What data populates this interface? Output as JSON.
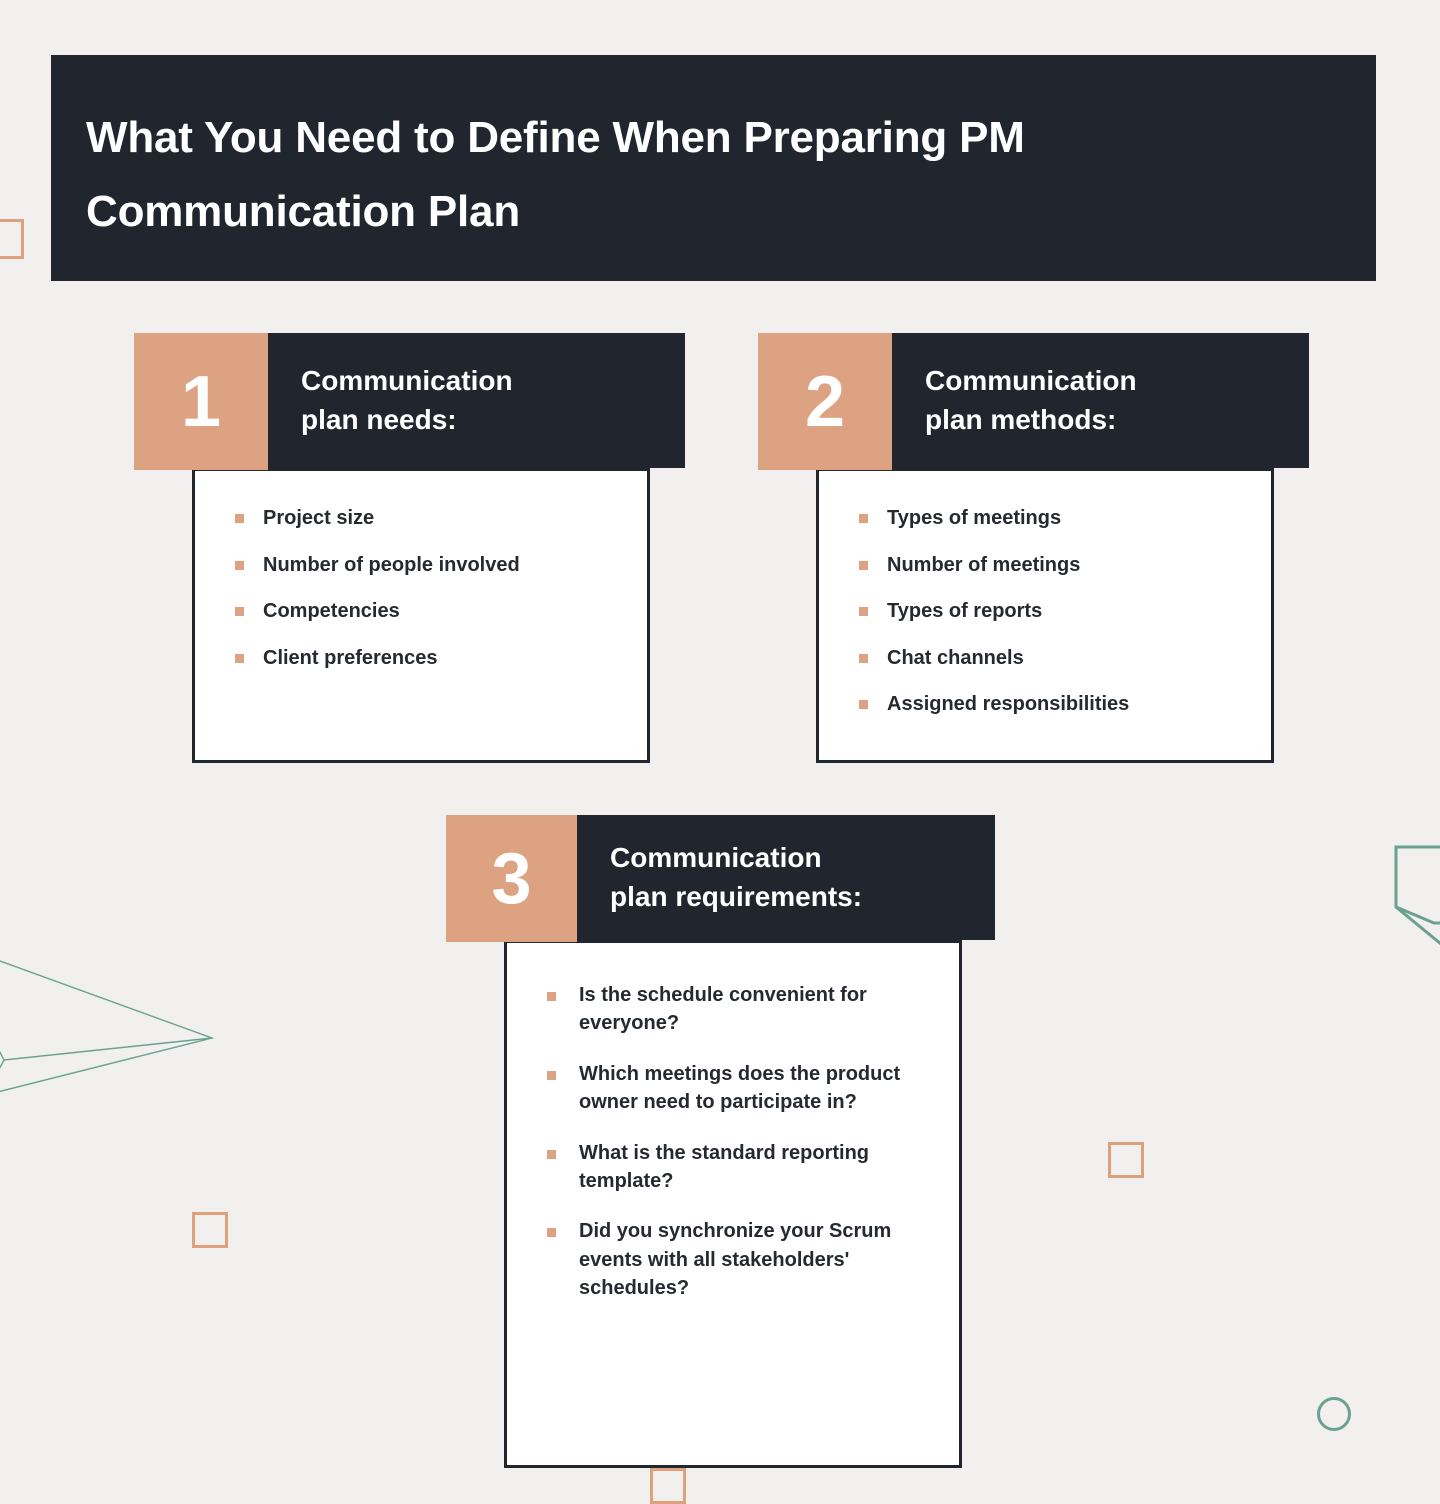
{
  "colors": {
    "background": "#f2f0ee",
    "dark": "#21262e",
    "accent_orange": "#dda281",
    "accent_green": "#6aa193",
    "card_surface": "#ffffff",
    "text_dark": "#252a31",
    "text_light": "#ffffff"
  },
  "header": {
    "title": "What You Need to Define When Preparing PM Communication Plan"
  },
  "cards": [
    {
      "number": "1",
      "title": "Communication\nplan needs:",
      "items": [
        "Project size",
        "Number of people involved",
        "Competencies",
        "Client preferences"
      ]
    },
    {
      "number": "2",
      "title": "Communication\nplan methods:",
      "items": [
        "Types of meetings",
        "Number of meetings",
        "Types of reports",
        "Chat channels",
        "Assigned responsibilities"
      ]
    },
    {
      "number": "3",
      "title": "Communication\nplan requirements:",
      "items": [
        " Is the schedule convenient for everyone?",
        "Which meetings does the product owner need to participate in?",
        "What is the standard reporting template?",
        "Did you synchronize your Scrum events with all stakeholders' schedules?"
      ]
    }
  ],
  "decorations": [
    {
      "name": "outlined-square-left-edge",
      "shape": "square",
      "color": "#dfa07c"
    },
    {
      "name": "outlined-square-mid-left",
      "shape": "square",
      "color": "#dfa07c"
    },
    {
      "name": "outlined-square-right",
      "shape": "square",
      "color": "#dfa07c"
    },
    {
      "name": "outlined-square-bottom",
      "shape": "square",
      "color": "#dfa07c"
    },
    {
      "name": "outlined-circle-right",
      "shape": "circle",
      "color": "#6aa193"
    },
    {
      "name": "paper-plane-outline",
      "shape": "line-art",
      "color": "#6aa193"
    },
    {
      "name": "tag-outline-right-edge",
      "shape": "line-art",
      "color": "#6aa193"
    }
  ]
}
